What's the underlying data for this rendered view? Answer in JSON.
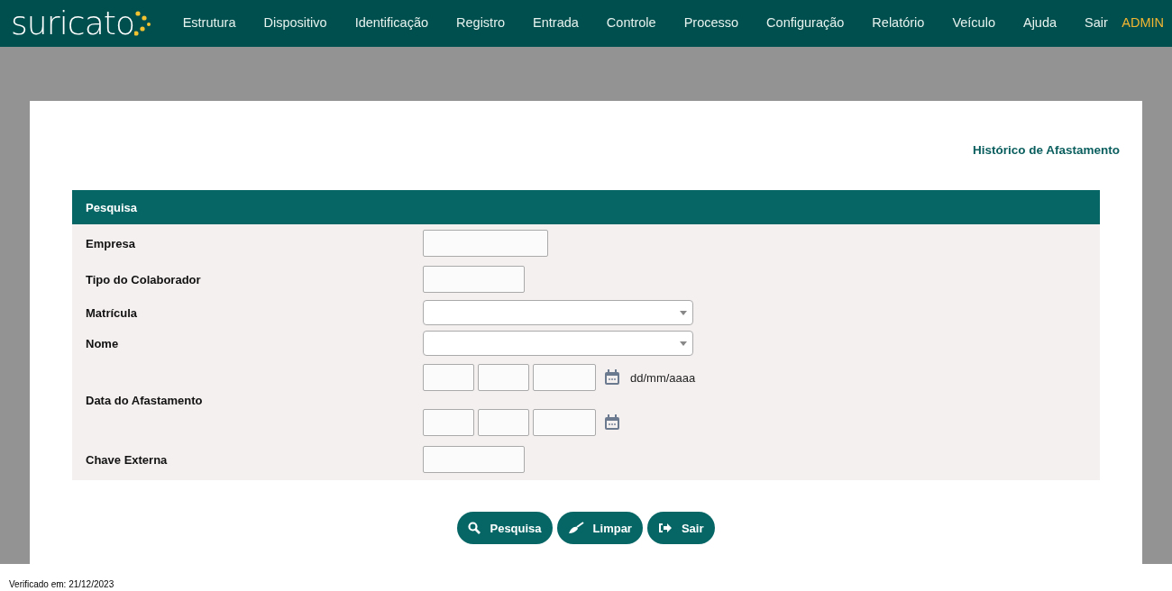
{
  "nav": {
    "logo": "suricato",
    "items": [
      "Estrutura",
      "Dispositivo",
      "Identificação",
      "Registro",
      "Entrada",
      "Controle",
      "Processo",
      "Configuração",
      "Relatório",
      "Veículo",
      "Ajuda",
      "Sair"
    ],
    "user": "ADMIN"
  },
  "page_title": "Histórico de Afastamento",
  "panel": {
    "title": "Pesquisa",
    "fields": [
      {
        "label": "Empresa",
        "kind": "text"
      },
      {
        "label": "Tipo do Colaborador",
        "kind": "short"
      },
      {
        "label": "Matrícula",
        "kind": "select"
      },
      {
        "label": "Nome",
        "kind": "select"
      },
      {
        "label": "Data do Afastamento",
        "kind": "date_range",
        "hint": "dd/mm/aaaa"
      },
      {
        "label": "Chave Externa",
        "kind": "short"
      }
    ]
  },
  "buttons": [
    {
      "label": "Pesquisa",
      "kind": "search"
    },
    {
      "label": "Limpar",
      "kind": "clear"
    },
    {
      "label": "Sair",
      "kind": "exit"
    }
  ],
  "footer": "Verificado em: 21/12/2023"
}
